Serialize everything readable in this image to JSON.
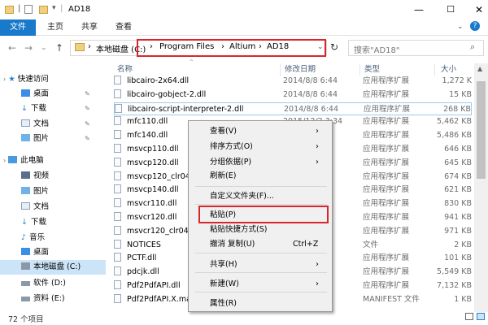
{
  "window": {
    "title": "AD18",
    "minimize": "—",
    "maximize": "☐",
    "close": "✕"
  },
  "ribbon": {
    "file": "文件",
    "home": "主页",
    "share": "共享",
    "view": "查看"
  },
  "address": {
    "root": "本地磁盘 (C:)",
    "crumbs": [
      "Program Files",
      "Altium",
      "AD18"
    ],
    "sep": "›",
    "search_placeholder": "搜索\"AD18\""
  },
  "sidebar": {
    "items": [
      {
        "label": "快速访问",
        "pinned": false
      },
      {
        "label": "桌面",
        "pinned": true
      },
      {
        "label": "下载",
        "pinned": true
      },
      {
        "label": "文档",
        "pinned": true
      },
      {
        "label": "图片",
        "pinned": true
      },
      {
        "label": "此电脑",
        "pinned": false
      },
      {
        "label": "视频",
        "pinned": false
      },
      {
        "label": "图片",
        "pinned": false
      },
      {
        "label": "文档",
        "pinned": false
      },
      {
        "label": "下载",
        "pinned": false
      },
      {
        "label": "音乐",
        "pinned": false
      },
      {
        "label": "桌面",
        "pinned": false
      },
      {
        "label": "本地磁盘 (C:)",
        "pinned": false
      },
      {
        "label": "软件 (D:)",
        "pinned": false
      },
      {
        "label": "资料 (E:)",
        "pinned": false
      }
    ]
  },
  "columns": {
    "name": "名称",
    "date": "修改日期",
    "type": "类型",
    "size": "大小"
  },
  "files": [
    {
      "name": "libcairo-2x64.dll",
      "date": "2014/8/8 6:44",
      "type": "应用程序扩展",
      "size": "1,272 K"
    },
    {
      "name": "libcairo-gobject-2.dll",
      "date": "2014/8/8 6:44",
      "type": "应用程序扩展",
      "size": "15 KB"
    },
    {
      "name": "libcairo-script-interpreter-2.dll",
      "date": "2014/8/8 6:44",
      "type": "应用程序扩展",
      "size": "268 KB"
    },
    {
      "name": "mfc110.dll",
      "date": "2015/12/2 3:34",
      "type": "应用程序扩展",
      "size": "5,462 KB"
    },
    {
      "name": "mfc140.dll",
      "date": "",
      "type": "应用程序扩展",
      "size": "5,486 KB"
    },
    {
      "name": "msvcp110.dll",
      "date": "",
      "type": "应用程序扩展",
      "size": "646 KB"
    },
    {
      "name": "msvcp120.dll",
      "date": "20:03",
      "type": "应用程序扩展",
      "size": "645 KB"
    },
    {
      "name": "msvcp120_clr04",
      "date": "20:03",
      "type": "应用程序扩展",
      "size": "674 KB"
    },
    {
      "name": "msvcp140.dll",
      "date": "20:03",
      "type": "应用程序扩展",
      "size": "621 KB"
    },
    {
      "name": "msvcr110.dll",
      "date": "",
      "type": "应用程序扩展",
      "size": "830 KB"
    },
    {
      "name": "msvcr120.dll",
      "date": "20:03",
      "type": "应用程序扩展",
      "size": "941 KB"
    },
    {
      "name": "msvcr120_clr04",
      "date": "20:03",
      "type": "应用程序扩展",
      "size": "971 KB"
    },
    {
      "name": "NOTICES",
      "date": "",
      "type": "文件",
      "size": "2 KB"
    },
    {
      "name": "PCTF.dll",
      "date": "",
      "type": "应用程序扩展",
      "size": "101 KB"
    },
    {
      "name": "pdcjk.dll",
      "date": "",
      "type": "应用程序扩展",
      "size": "5,549 KB"
    },
    {
      "name": "Pdf2PdfAPI.dll",
      "date": "",
      "type": "应用程序扩展",
      "size": "7,132 KB"
    },
    {
      "name": "Pdf2PdfAPI.X.man",
      "date": "",
      "type": "MANIFEST 文件",
      "size": "1 KB"
    }
  ],
  "status": {
    "count": "72 个项目"
  },
  "context_menu": {
    "items": [
      {
        "label": "查看(V)",
        "submenu": true
      },
      {
        "label": "排序方式(O)",
        "submenu": true
      },
      {
        "label": "分组依据(P)",
        "submenu": true
      },
      {
        "label": "刷新(E)",
        "submenu": false
      },
      {
        "label": "自定义文件夹(F)...",
        "submenu": false
      },
      {
        "label": "粘贴(P)",
        "submenu": false
      },
      {
        "label": "粘贴快捷方式(S)",
        "submenu": false
      },
      {
        "label": "撤消 复制(U)",
        "submenu": false,
        "shortcut": "Ctrl+Z"
      },
      {
        "label": "共享(H)",
        "submenu": true
      },
      {
        "label": "新建(W)",
        "submenu": true
      },
      {
        "label": "属性(R)",
        "submenu": false
      }
    ],
    "arrow": "›"
  },
  "colors": {
    "accent": "#1979ca",
    "highlight_border": "#d9262d",
    "selected_bg": "#cce4f7"
  }
}
